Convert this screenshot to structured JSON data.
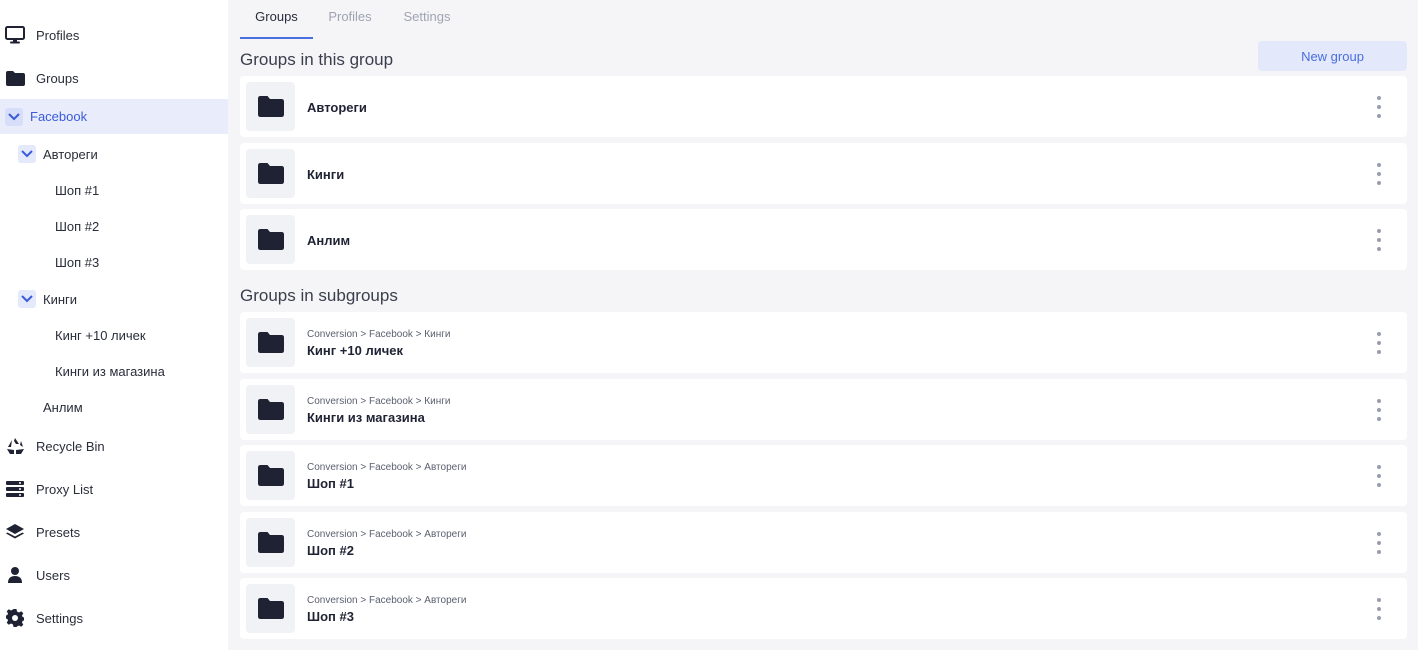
{
  "sidebar": {
    "top_items": [
      {
        "label": "Profiles",
        "icon": "monitor-icon"
      },
      {
        "label": "Groups",
        "icon": "folder-icon"
      }
    ],
    "active_group": {
      "label": "Facebook",
      "icon": "chevron-down-icon"
    },
    "tree": [
      {
        "label": "Автореги",
        "expanded": true,
        "children": [
          "Шоп #1",
          "Шоп #2",
          "Шоп #3"
        ]
      },
      {
        "label": "Кинги",
        "expanded": true,
        "children": [
          "Кинг +10 личек",
          "Кинги из магазина"
        ]
      },
      {
        "label": "Анлим",
        "expanded": false,
        "children": []
      }
    ],
    "bottom_items": [
      {
        "label": "Recycle Bin",
        "icon": "recycle-icon"
      },
      {
        "label": "Proxy List",
        "icon": "server-icon"
      },
      {
        "label": "Presets",
        "icon": "layers-icon"
      },
      {
        "label": "Users",
        "icon": "user-icon"
      },
      {
        "label": "Settings",
        "icon": "gear-icon"
      }
    ]
  },
  "tabs": [
    {
      "label": "Groups",
      "active": true
    },
    {
      "label": "Profiles",
      "active": false
    },
    {
      "label": "Settings",
      "active": false
    }
  ],
  "section_this_group": {
    "title": "Groups in this group",
    "new_group_label": "New group",
    "items": [
      {
        "name": "Автореги"
      },
      {
        "name": "Кинги"
      },
      {
        "name": "Анлим"
      }
    ]
  },
  "section_subgroups": {
    "title": "Groups in subgroups",
    "items": [
      {
        "path": "Conversion > Facebook > Кинги",
        "name": "Кинг +10 личек"
      },
      {
        "path": "Conversion > Facebook > Кинги",
        "name": "Кинги из магазина"
      },
      {
        "path": "Conversion > Facebook > Автореги",
        "name": "Шоп #1"
      },
      {
        "path": "Conversion > Facebook > Автореги",
        "name": "Шоп #2"
      },
      {
        "path": "Conversion > Facebook > Автореги",
        "name": "Шоп #3"
      }
    ]
  },
  "colors": {
    "accent": "#4a6ee0",
    "active_bg": "#e8ecfb",
    "folder": "#1f2233",
    "background": "#f5f5f8"
  }
}
